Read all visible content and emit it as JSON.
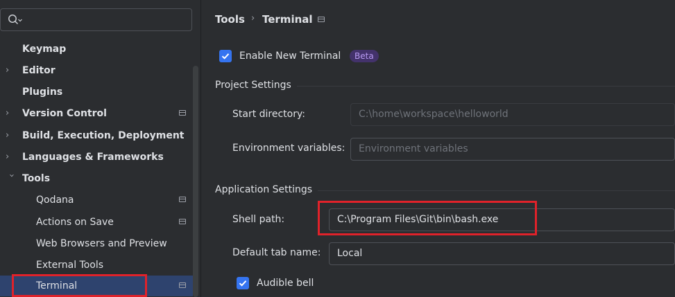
{
  "sidebar": {
    "search": {
      "value": "",
      "placeholder": ""
    },
    "items": [
      {
        "label": "Keymap"
      },
      {
        "label": "Editor"
      },
      {
        "label": "Plugins"
      },
      {
        "label": "Version Control"
      },
      {
        "label": "Build, Execution, Deployment"
      },
      {
        "label": "Languages & Frameworks"
      },
      {
        "label": "Tools"
      },
      {
        "label": "Qodana"
      },
      {
        "label": "Actions on Save"
      },
      {
        "label": "Web Browsers and Preview"
      },
      {
        "label": "External Tools"
      },
      {
        "label": "Terminal"
      }
    ]
  },
  "breadcrumb": {
    "parent": "Tools",
    "separator": "›",
    "current": "Terminal"
  },
  "enable_new_terminal": {
    "label": "Enable New Terminal",
    "checked": true,
    "badge": "Beta"
  },
  "project_settings": {
    "title": "Project Settings",
    "start_directory": {
      "label": "Start directory:",
      "value": "C:\\home\\workspace\\helloworld"
    },
    "environment_variables": {
      "label": "Environment variables:",
      "placeholder": "Environment variables"
    }
  },
  "application_settings": {
    "title": "Application Settings",
    "shell_path": {
      "label": "Shell path:",
      "value": "C:\\Program Files\\Git\\bin\\bash.exe"
    },
    "default_tab_name": {
      "label": "Default tab name:",
      "value": "Local"
    },
    "audible_bell": {
      "label": "Audible bell",
      "checked": true
    }
  },
  "colors": {
    "background": "#2b2d30",
    "selection": "#2e436e",
    "accent": "#3574f0",
    "highlight": "#e0222a"
  }
}
